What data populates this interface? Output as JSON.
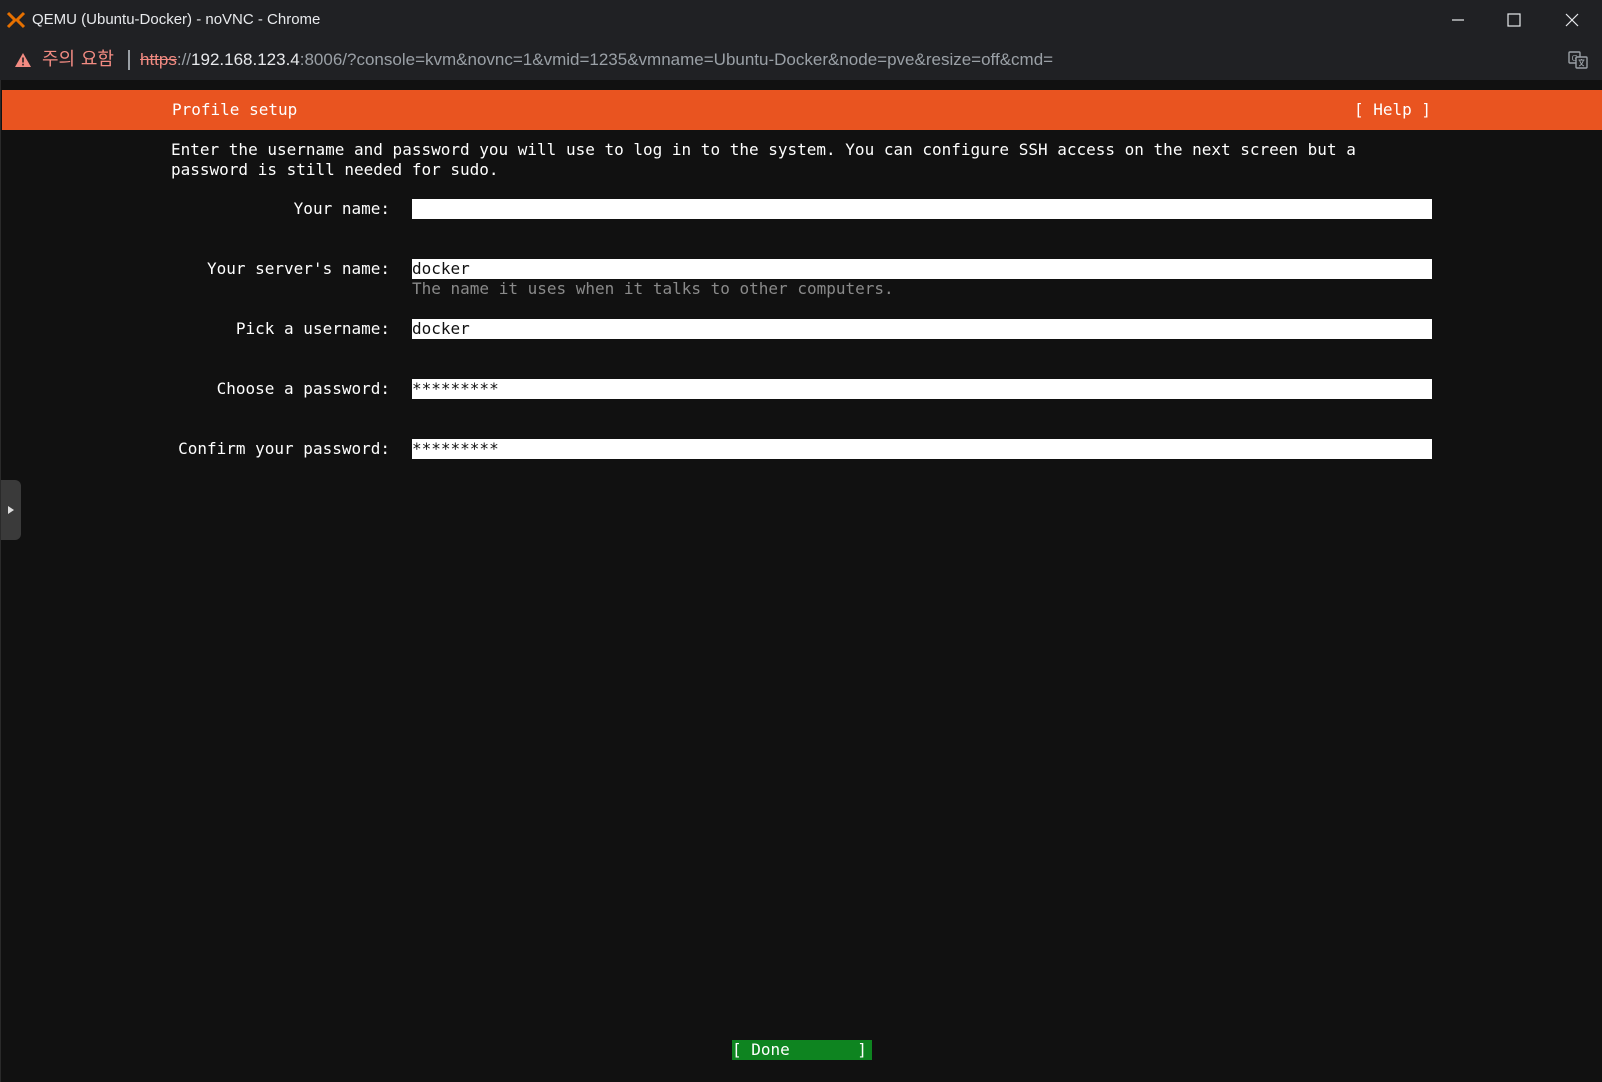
{
  "window": {
    "title": "QEMU (Ubuntu-Docker) - noVNC - Chrome",
    "icons": {
      "app": "proxmox-x-icon",
      "minimize": "minimize-icon",
      "maximize": "maximize-icon",
      "close": "close-icon"
    }
  },
  "addressbar": {
    "security_label": "주의 요함",
    "separator": "|",
    "url_scheme": "https",
    "url_scheme_sep": "://",
    "url_host": "192.168.123.4",
    "url_rest": ":8006/?console=kvm&novnc=1&vmid=1235&vmname=Ubuntu-Docker&node=pve&resize=off&cmd=",
    "icons": {
      "warning": "warning-triangle-icon",
      "translate": "translate-icon"
    }
  },
  "installer": {
    "header_title": "Profile setup",
    "help_label": "[ Help ]",
    "intro_text": "Enter the username and password you will use to log in to the system. You can configure SSH access on the next screen but a\npassword is still needed for sudo.",
    "fields": [
      {
        "label": "Your name:",
        "value": ""
      },
      {
        "label": "Your server's name:",
        "value": "docker",
        "hint": "The name it uses when it talks to other computers."
      },
      {
        "label": "Pick a username:",
        "value": "docker"
      },
      {
        "label": "Choose a password:",
        "value": "*********"
      },
      {
        "label": "Confirm your password:",
        "value": "*********"
      }
    ],
    "done_label": "[ Done       ]"
  },
  "colors": {
    "header_orange": "#e95420",
    "done_green": "#0e8420",
    "console_bg": "#111111",
    "chrome_bg": "#202124",
    "warning_red": "#f28b82"
  }
}
